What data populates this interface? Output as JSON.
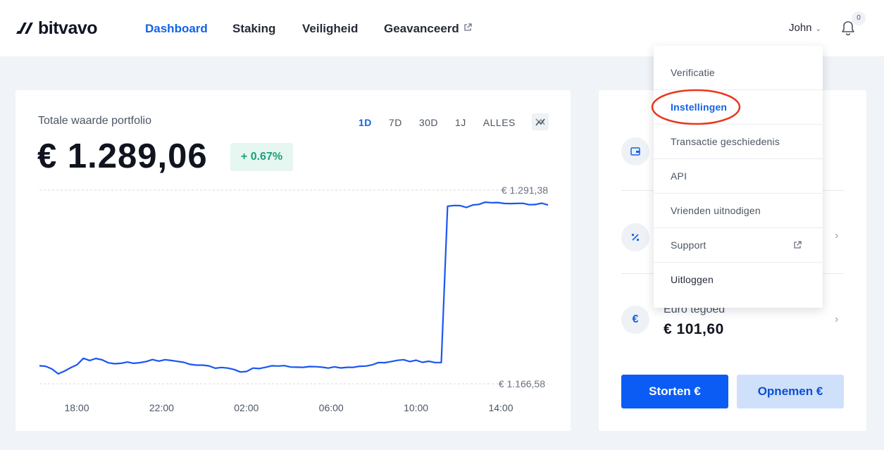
{
  "header": {
    "logo_text": "bitvavo",
    "nav": [
      {
        "label": "Dashboard",
        "active": true
      },
      {
        "label": "Staking"
      },
      {
        "label": "Veiligheid"
      },
      {
        "label": "Geavanceerd",
        "external": true
      }
    ],
    "user_name": "John",
    "notifications_count": "0"
  },
  "portfolio": {
    "title": "Totale waarde portfolio",
    "value": "€ 1.289,06",
    "change": "+ 0.67%",
    "ranges": [
      "1D",
      "7D",
      "30D",
      "1J",
      "ALLES"
    ],
    "active_range": "1D"
  },
  "chart_data": {
    "type": "line",
    "max_label": "€ 1.291,38",
    "min_label": "€ 1.166,58",
    "x_ticks": [
      "18:00",
      "22:00",
      "02:00",
      "06:00",
      "10:00",
      "14:00"
    ],
    "ylim": [
      1166.58,
      1291.38
    ],
    "series": [
      {
        "values": [
          1178.2,
          1177.9,
          1176.1,
          1173.0,
          1174.8,
          1177.0,
          1178.9,
          1183.0,
          1181.6,
          1182.9,
          1182.0,
          1180.1,
          1179.5,
          1179.8,
          1180.6,
          1179.8,
          1180.2,
          1180.9,
          1182.2,
          1181.2,
          1182.1,
          1181.6,
          1181.0,
          1180.4,
          1179.1,
          1178.6,
          1178.6,
          1178.1,
          1176.6,
          1177.1,
          1176.7,
          1175.8,
          1174.2,
          1174.5,
          1176.7,
          1176.4,
          1177.2,
          1178.2,
          1178.0,
          1178.3,
          1177.4,
          1177.3,
          1177.2,
          1177.7,
          1177.6,
          1177.3,
          1176.7,
          1177.5,
          1176.8,
          1177.2,
          1177.2,
          1177.9,
          1178.0,
          1178.8,
          1180.3,
          1180.2,
          1180.9,
          1181.7,
          1182.1,
          1180.9,
          1181.8,
          1180.4,
          1181.1,
          1180.3,
          1180.3,
          1281.0,
          1281.5,
          1281.4,
          1280.2,
          1281.8,
          1282.2,
          1283.6,
          1283.3,
          1283.4,
          1282.8,
          1282.7,
          1282.8,
          1282.9,
          1282.0,
          1282.1,
          1283.0,
          1281.8
        ]
      }
    ]
  },
  "side": {
    "euro_label": "Euro tegoed",
    "euro_value": "€ 101,60",
    "deposit_label": "Storten €",
    "withdraw_label": "Opnemen €"
  },
  "dropdown": {
    "items": [
      {
        "label": "Verificatie"
      },
      {
        "label": "Instellingen",
        "active": true
      },
      {
        "label": "Transactie geschiedenis"
      },
      {
        "label": "API"
      },
      {
        "label": "Vrienden uitnodigen"
      },
      {
        "label": "Support",
        "external": true
      },
      {
        "label": "Uitloggen"
      }
    ]
  },
  "colors": {
    "accent": "#1262e8",
    "primary_button": "#0a5cf5",
    "annotation": "#e8361c",
    "positive": "#1aa37a"
  }
}
